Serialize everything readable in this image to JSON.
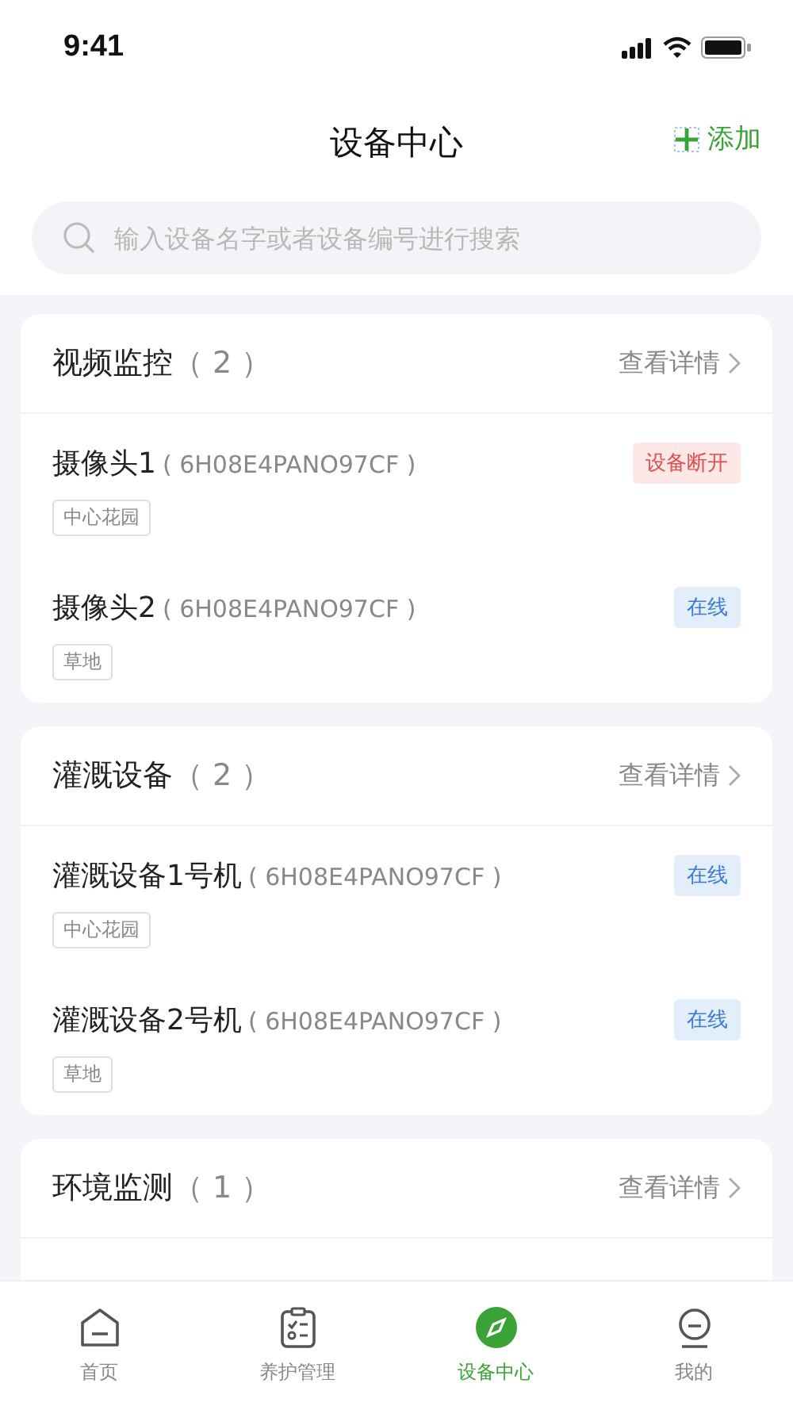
{
  "status_bar": {
    "time": "9:41"
  },
  "header": {
    "title": "设备中心",
    "add_label": "添加"
  },
  "search": {
    "placeholder": "输入设备名字或者设备编号进行搜索"
  },
  "groups": [
    {
      "title": "视频监控",
      "count": "（ 2 ）",
      "details": "查看详情",
      "devices": [
        {
          "name": "摄像头1",
          "code": "( 6H08E4PANO97CF )",
          "tag": "中心花园",
          "status": {
            "text": "设备断开",
            "kind": "offline"
          }
        },
        {
          "name": "摄像头2",
          "code": "( 6H08E4PANO97CF )",
          "tag": "草地",
          "status": {
            "text": "在线",
            "kind": "online"
          }
        }
      ]
    },
    {
      "title": "灌溉设备",
      "count": "（ 2 ）",
      "details": "查看详情",
      "devices": [
        {
          "name": "灌溉设备1号机",
          "code": "( 6H08E4PANO97CF )",
          "tag": "中心花园",
          "status": {
            "text": "在线",
            "kind": "online"
          }
        },
        {
          "name": "灌溉设备2号机",
          "code": "( 6H08E4PANO97CF )",
          "tag": "草地",
          "status": {
            "text": "在线",
            "kind": "online"
          }
        }
      ]
    },
    {
      "title": "环境监测",
      "count": "（ 1 ）",
      "details": "查看详情"
    }
  ],
  "tabs": [
    {
      "label": "首页",
      "kind": "home",
      "selected": false
    },
    {
      "label": "养护管理",
      "kind": "care",
      "selected": false
    },
    {
      "label": "设备中心",
      "kind": "devices",
      "selected": true
    },
    {
      "label": "我的",
      "kind": "mine",
      "selected": false
    }
  ]
}
